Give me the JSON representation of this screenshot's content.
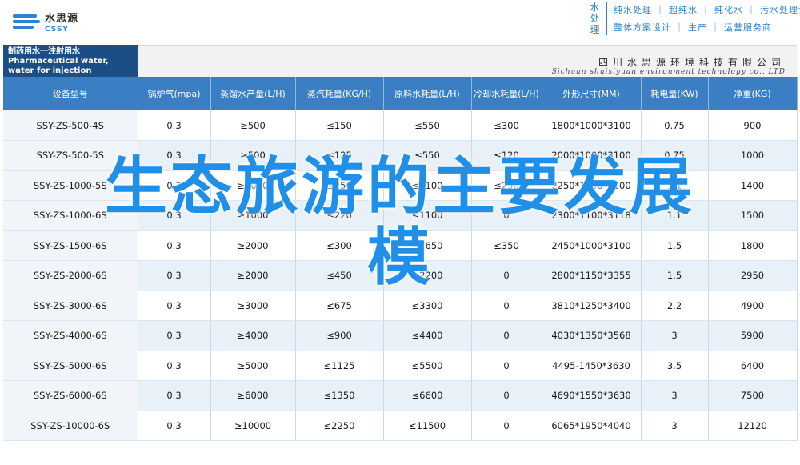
{
  "logo": {
    "cn": "水思源",
    "en": "CSSY"
  },
  "brand": {
    "vertical": "水处理",
    "line1": "纯水处理 ｜ 超纯水 ｜ 纯化水 ｜ 污水处理设备",
    "line2": "整体方案设计 ｜ 生产 ｜ 运营服务商"
  },
  "product_title": "制药用水一注射用水 Pharmaceutical water, water for injection",
  "company": {
    "cn": "四川水思源环境科技有限公司",
    "en": "Sichuan shuisiyuan environment technology co., LTD"
  },
  "table": {
    "headers": [
      "设备型号",
      "锅炉气(mpa)",
      "蒸馏水产量(L/H)",
      "蒸汽耗量(KG/H)",
      "原料水耗量(L/H)",
      "冷却水耗量(L/H)",
      "外形尺寸(MM)",
      "耗电量(KW)",
      "净重(KG)"
    ],
    "rows": [
      [
        "SSY-ZS-500-4S",
        "0.3",
        "≥500",
        "≤150",
        "≤550",
        "≤300",
        "1800*1000*3100",
        "0.75",
        "900"
      ],
      [
        "SSY-ZS-500-5S",
        "0.3",
        "≥500",
        "≤125",
        "≤550",
        "≤120",
        "2000*1000*3100",
        "0.75",
        "1000"
      ],
      [
        "SSY-ZS-1000-5S",
        "0.3",
        "≥1000",
        "≤250",
        "≤1100",
        "≤250",
        "2250*1000*3100",
        "1.1",
        "1400"
      ],
      [
        "SSY-ZS-1000-6S",
        "0.3",
        "≥1000",
        "≤220",
        "≤1100",
        "0",
        "2300*1100*3118",
        "1.1",
        "1500"
      ],
      [
        "SSY-ZS-1500-6S",
        "0.3",
        "≥2000",
        "≤300",
        "≤1650",
        "≤350",
        "2450*1000*3100",
        "1.5",
        "1800"
      ],
      [
        "SSY-ZS-2000-6S",
        "0.3",
        "≥2000",
        "≤450",
        "≤2200",
        "0",
        "2800*1150*3355",
        "1.5",
        "2950"
      ],
      [
        "SSY-ZS-3000-6S",
        "0.3",
        "≥3000",
        "≤675",
        "≤3300",
        "0",
        "3810*1250*3400",
        "2.2",
        "4900"
      ],
      [
        "SSY-ZS-4000-6S",
        "0.3",
        "≥4000",
        "≤900",
        "≤4400",
        "0",
        "4030*1350*3568",
        "3",
        "5900"
      ],
      [
        "SSY-ZS-5000-6S",
        "0.3",
        "≥5000",
        "≤1125",
        "≤5500",
        "0",
        "4495-1450*3630",
        "3.5",
        "6400"
      ],
      [
        "SSY-ZS-6000-6S",
        "0.3",
        "≥6000",
        "≤1350",
        "≤6600",
        "0",
        "4690*1550*3630",
        "3",
        "7500"
      ],
      [
        "SSY-ZS-10000-6S",
        "0.3",
        "≥10000",
        "≤2250",
        "≤11500",
        "0",
        "6065*1950*4040",
        "3",
        "12120"
      ]
    ]
  },
  "overlay": {
    "line1": "生态旅游的主要发展",
    "line2": "模"
  },
  "colors": {
    "header_blue": "#3a7fc4",
    "overlay_blue": "#1f8fe8",
    "navy": "#1c4e86"
  }
}
